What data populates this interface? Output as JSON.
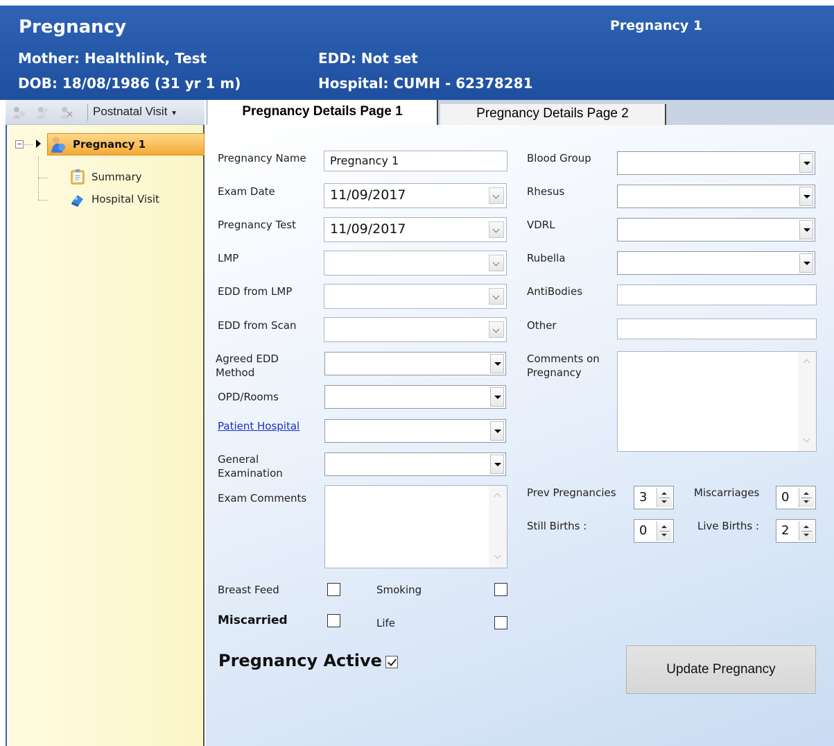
{
  "header": {
    "title": "Pregnancy",
    "pregnancy_name": "Pregnancy 1",
    "mother": "Mother: Healthlink, Test",
    "edd": "EDD: Not set",
    "dob": "DOB: 18/08/1986 (31 yr 1 m)",
    "hospital": "Hospital: CUMH - 62378281",
    "colors": {
      "header_bg": "#1f4f9f",
      "selected_tree": "#f6a935"
    }
  },
  "toolbar": {
    "icons": [
      "pregnancy-add-icon",
      "pregnancy-edit-icon",
      "pregnancy-delete-icon"
    ],
    "postnatal_label": "Postnatal Visit"
  },
  "tree": {
    "root": "Pregnancy 1",
    "children": [
      {
        "label": "Summary",
        "icon": "summary-icon"
      },
      {
        "label": "Hospital Visit",
        "icon": "hospital-visit-icon"
      }
    ]
  },
  "tabs": [
    {
      "label": "Pregnancy Details Page 1",
      "active": true
    },
    {
      "label": "Pregnancy Details Page 2",
      "active": false
    }
  ],
  "form": {
    "pregnancy_name": {
      "label": "Pregnancy Name",
      "value": "Pregnancy 1"
    },
    "exam_date": {
      "label": "Exam Date",
      "value": "11/09/2017"
    },
    "pregnancy_test": {
      "label": "Pregnancy Test",
      "value": "11/09/2017"
    },
    "lmp": {
      "label": "LMP",
      "value": ""
    },
    "edd_from_lmp": {
      "label": "EDD from LMP",
      "value": ""
    },
    "edd_from_scan": {
      "label": "EDD from Scan",
      "value": ""
    },
    "agreed_edd_method": {
      "label_line1": "Agreed EDD",
      "label_line2": "Method",
      "value": ""
    },
    "opd_rooms": {
      "label": "OPD/Rooms",
      "value": ""
    },
    "patient_hospital": {
      "label": "Patient Hospital",
      "value": ""
    },
    "general_examination": {
      "label_line1": "General",
      "label_line2": "Examination",
      "value": ""
    },
    "exam_comments": {
      "label": "Exam Comments",
      "value": ""
    },
    "blood_group": {
      "label": "Blood Group",
      "value": ""
    },
    "rhesus": {
      "label": "Rhesus",
      "value": ""
    },
    "vdrl": {
      "label": "VDRL",
      "value": ""
    },
    "rubella": {
      "label": "Rubella",
      "value": ""
    },
    "antibodies": {
      "label": "AntiBodies",
      "value": ""
    },
    "other": {
      "label": "Other",
      "value": ""
    },
    "comments_on_pregnancy": {
      "label_line1": "Comments on",
      "label_line2": "Pregnancy",
      "value": ""
    },
    "prev_pregnancies": {
      "label": "Prev Pregnancies",
      "value": "3"
    },
    "miscarriages": {
      "label": "Miscarriages",
      "value": "0"
    },
    "still_births": {
      "label": "Still Births :",
      "value": "0"
    },
    "live_births": {
      "label": "Live Births :",
      "value": "2"
    },
    "breast_feed": {
      "label": "Breast Feed",
      "checked": false
    },
    "smoking": {
      "label": "Smoking",
      "checked": false
    },
    "miscarried": {
      "label": "Miscarried",
      "checked": false
    },
    "life": {
      "label": "Life",
      "checked": false
    },
    "pregnancy_active": {
      "label": "Pregnancy Active",
      "checked": true
    }
  },
  "buttons": {
    "update": "Update Pregnancy"
  }
}
